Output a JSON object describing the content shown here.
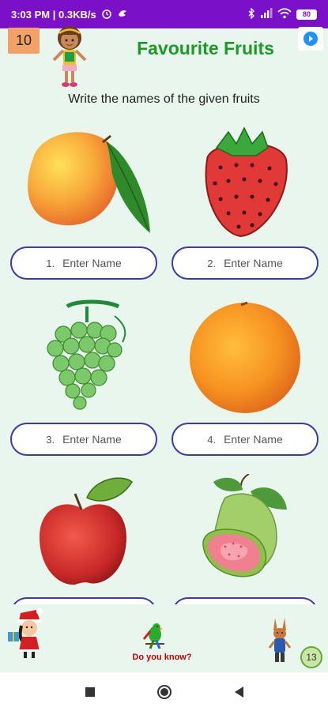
{
  "status_bar": {
    "time_speed": "3:03 PM | 0.3KB/s",
    "battery": "80"
  },
  "header": {
    "page_number": "10",
    "title": "Favourite Fruits"
  },
  "instructions": "Write the names of the given fruits",
  "fruits": [
    {
      "number": "1.",
      "placeholder": "Enter Name",
      "icon": "mango-image"
    },
    {
      "number": "2.",
      "placeholder": "Enter Name",
      "icon": "strawberry-image"
    },
    {
      "number": "3.",
      "placeholder": "Enter Name",
      "icon": "grapes-image"
    },
    {
      "number": "4.",
      "placeholder": "Enter Name",
      "icon": "orange-image"
    },
    {
      "number": "",
      "placeholder": "",
      "icon": "apple-image"
    },
    {
      "number": "",
      "placeholder": "",
      "icon": "guava-image"
    }
  ],
  "bottom": {
    "do_you_know": "Do you know?",
    "counter": "13"
  },
  "colors": {
    "status_bar": "#7a10c8",
    "title": "#1b9a25",
    "background": "#e8f6ee",
    "pill_border": "#3d3aa8"
  }
}
